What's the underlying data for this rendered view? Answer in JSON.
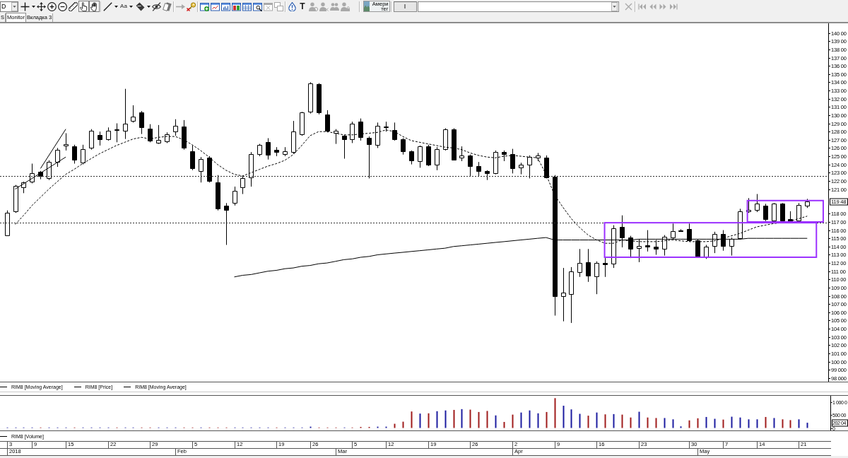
{
  "toolbar": {
    "interval": {
      "value": "D"
    },
    "groups": [
      [
        {
          "kind": "icon",
          "dropdown": true,
          "pressed": false,
          "disabled": false
        },
        {
          "kind": "icon",
          "dropdown": false,
          "pressed": false,
          "disabled": false
        },
        {
          "kind": "icon",
          "dropdown": false,
          "pressed": false,
          "disabled": false
        },
        {
          "kind": "icon",
          "dropdown": false,
          "pressed": false,
          "disabled": false
        },
        {
          "kind": "icon",
          "dropdown": false,
          "pressed": false,
          "disabled": false
        },
        {
          "kind": "icon",
          "dropdown": false,
          "pressed": true,
          "disabled": false
        },
        {
          "kind": "icon",
          "dropdown": false,
          "pressed": true,
          "disabled": false
        }
      ],
      [
        {
          "kind": "icon",
          "dropdown": true,
          "pressed": false,
          "disabled": false
        },
        {
          "kind": "text",
          "label": "Aa",
          "dropdown": true,
          "pressed": false,
          "disabled": false
        },
        {
          "kind": "icon",
          "dropdown": true,
          "pressed": false,
          "disabled": false
        },
        {
          "kind": "icon",
          "dropdown": false,
          "pressed": false,
          "disabled": false
        },
        {
          "kind": "icon",
          "dropdown": false,
          "pressed": false,
          "disabled": false
        }
      ],
      [
        {
          "kind": "icon",
          "dropdown": false,
          "pressed": false,
          "disabled": true
        },
        {
          "kind": "icon",
          "dropdown": false,
          "pressed": false,
          "disabled": false
        }
      ],
      [
        {
          "kind": "icon",
          "dropdown": false,
          "pressed": false,
          "disabled": false
        },
        {
          "kind": "icon",
          "dropdown": false,
          "pressed": false,
          "disabled": false
        },
        {
          "kind": "icon",
          "dropdown": false,
          "pressed": false,
          "disabled": false
        },
        {
          "kind": "icon",
          "dropdown": false,
          "pressed": false,
          "disabled": false
        },
        {
          "kind": "icon",
          "dropdown": false,
          "pressed": false,
          "disabled": false
        },
        {
          "kind": "icon",
          "dropdown": false,
          "pressed": false,
          "disabled": false
        },
        {
          "kind": "icon",
          "dropdown": false,
          "pressed": false,
          "disabled": true
        },
        {
          "kind": "icon",
          "dropdown": false,
          "pressed": false,
          "disabled": true
        }
      ],
      [
        {
          "kind": "icon",
          "dropdown": false,
          "pressed": false,
          "disabled": false
        },
        {
          "kind": "glyph",
          "label": "T",
          "dropdown": false,
          "pressed": false,
          "disabled": false
        },
        {
          "kind": "icon",
          "dropdown": false,
          "pressed": false,
          "disabled": true
        },
        {
          "kind": "icon",
          "dropdown": false,
          "pressed": false,
          "disabled": true
        },
        {
          "kind": "icon",
          "dropdown": false,
          "pressed": false,
          "disabled": true
        },
        {
          "kind": "icon",
          "dropdown": false,
          "pressed": false,
          "disabled": true
        }
      ]
    ],
    "instrument": {
      "lines": [
        "Амери",
        "тег"
      ]
    },
    "field": {
      "value": "I"
    },
    "close": {
      "disabled": true
    },
    "navigation": [
      {
        "disabled": true
      },
      {
        "disabled": true
      },
      {
        "disabled": true
      },
      {
        "disabled": true
      }
    ]
  },
  "tabs": [
    {
      "label": "S",
      "selected": false
    },
    {
      "label": "Monitor",
      "selected": true
    },
    {
      "label": "Вкладка 3",
      "selected": false
    }
  ],
  "price_chart": {
    "last_price_label": "119 48",
    "legend": [
      "RIM8 [Moving Average]",
      "RIM8 [Price]",
      "RIM8 [Moving Average]"
    ],
    "chart_data": {
      "type": "line",
      "ylim": [
        97550,
        141180
      ],
      "yticks": [
        {
          "value": 140000,
          "label": "140 00"
        },
        {
          "value": 139000,
          "label": "139 00"
        },
        {
          "value": 138000,
          "label": "138 00"
        },
        {
          "value": 137000,
          "label": "137 00"
        },
        {
          "value": 136000,
          "label": "136 00"
        },
        {
          "value": 135000,
          "label": "135 00"
        },
        {
          "value": 134000,
          "label": "134 00"
        },
        {
          "value": 133000,
          "label": "133 00"
        },
        {
          "value": 132000,
          "label": "132 00"
        },
        {
          "value": 131000,
          "label": "131 00"
        },
        {
          "value": 130000,
          "label": "130 00"
        },
        {
          "value": 129000,
          "label": "129 00"
        },
        {
          "value": 128000,
          "label": "128 00"
        },
        {
          "value": 127000,
          "label": "127 00"
        },
        {
          "value": 126000,
          "label": "126 00"
        },
        {
          "value": 125000,
          "label": "125 00"
        },
        {
          "value": 124000,
          "label": "124 00"
        },
        {
          "value": 123000,
          "label": "123 00"
        },
        {
          "value": 122000,
          "label": "122 00"
        },
        {
          "value": 121000,
          "label": "121 00"
        },
        {
          "value": 118000,
          "label": "118 00"
        },
        {
          "value": 117000,
          "label": "117 00"
        },
        {
          "value": 116000,
          "label": "116 00"
        },
        {
          "value": 115000,
          "label": "115 00"
        },
        {
          "value": 114000,
          "label": "114 00"
        },
        {
          "value": 113000,
          "label": "113 00"
        },
        {
          "value": 112000,
          "label": "112 00"
        },
        {
          "value": 111000,
          "label": "111 00"
        },
        {
          "value": 110000,
          "label": "110 00"
        },
        {
          "value": 109000,
          "label": "109 00"
        },
        {
          "value": 108000,
          "label": "108 00"
        },
        {
          "value": 107000,
          "label": "107 00"
        },
        {
          "value": 106000,
          "label": "106 00"
        },
        {
          "value": 105000,
          "label": "105 00"
        },
        {
          "value": 104000,
          "label": "104 00"
        },
        {
          "value": 103000,
          "label": "103 00"
        },
        {
          "value": 102000,
          "label": "102 00"
        },
        {
          "value": 101000,
          "label": "101 00"
        },
        {
          "value": 100000,
          "label": "100 00"
        },
        {
          "value": 99000,
          "label": "99 000"
        },
        {
          "value": 98000,
          "label": "98 000"
        }
      ],
      "series": [
        {
          "color": "#000000",
          "line_style": "dashed",
          "values": [
            null,
            116700,
            117800,
            119000,
            120000,
            121000,
            121900,
            122800,
            123400,
            124100,
            124700,
            125300,
            125800,
            126300,
            126700,
            127100,
            127300,
            127100,
            127300,
            127400,
            127400,
            127000,
            126400,
            125700,
            124900,
            124000,
            123300,
            122800,
            122600,
            123000,
            123400,
            123800,
            124100,
            124500,
            125200,
            126300,
            127500,
            128000,
            128000,
            127800,
            127600,
            127600,
            127700,
            127800,
            127900,
            128200,
            128000,
            127400,
            126900,
            126700,
            126500,
            126300,
            126100,
            126000,
            125800,
            125400,
            125100,
            124900,
            124800,
            125000,
            125100,
            125000,
            124900,
            124800,
            122800,
            120300,
            118800,
            117400,
            116300,
            115400,
            114800,
            114400,
            114400,
            114800,
            114700,
            114600,
            114600,
            114600,
            114700,
            114800,
            114700,
            114600,
            114600,
            114600,
            114700,
            115000,
            115300,
            115600,
            116000,
            116400,
            116600,
            116800,
            116900,
            117100,
            117400,
            117700
          ]
        },
        {
          "color": "#000000",
          "values": [
            null,
            null,
            null,
            null,
            null,
            null,
            null,
            null,
            null,
            null,
            null,
            null,
            null,
            null,
            null,
            null,
            null,
            null,
            null,
            null,
            null,
            null,
            null,
            null,
            null,
            null,
            null,
            110300,
            110500,
            110600,
            110800,
            111000,
            111100,
            111300,
            111400,
            111600,
            111700,
            111900,
            112000,
            112200,
            112400,
            112500,
            112700,
            112800,
            113000,
            113100,
            113200,
            113300,
            113400,
            113500,
            113600,
            113700,
            113800,
            114000,
            114100,
            114200,
            114300,
            114400,
            114500,
            114600,
            114700,
            114800,
            114900,
            115000,
            115100,
            114800,
            114800,
            114800,
            114800,
            114800,
            114800,
            114800,
            114800,
            114800,
            114800,
            114900,
            114900,
            114900,
            114900,
            114900,
            114900,
            114900,
            114900,
            114900,
            114900,
            114900,
            114900,
            114900,
            115000,
            115000,
            115000,
            115000,
            115000,
            115000,
            115000,
            115000
          ]
        },
        {
          "color": "#000000",
          "values": [
            null,
            121000,
            null,
            null,
            null,
            null,
            null,
            124900,
            null,
            null,
            null,
            null,
            null,
            null,
            null,
            null,
            null,
            null,
            null,
            null,
            null,
            null,
            null,
            null,
            null,
            null,
            null,
            null,
            null,
            null,
            null,
            null,
            null,
            null,
            null,
            null,
            null,
            null,
            null,
            null,
            null,
            null,
            null,
            null,
            null,
            null,
            null,
            null,
            null,
            null,
            null,
            null,
            null,
            null,
            null,
            null,
            null,
            null,
            null,
            null,
            null,
            null,
            null,
            null,
            null,
            null,
            null,
            null,
            null,
            null,
            null,
            null,
            null,
            null,
            null,
            null,
            null,
            null,
            null,
            null,
            null,
            null,
            null,
            null,
            null,
            null,
            null,
            null,
            null,
            null,
            null,
            null,
            null,
            null,
            null,
            null
          ]
        },
        {
          "color": "#000000",
          "values": [
            null,
            null,
            null,
            null,
            123500,
            null,
            null,
            128300,
            null,
            null,
            null,
            null,
            null,
            null,
            null,
            null,
            null,
            null,
            null,
            null,
            null,
            null,
            null,
            null,
            null,
            null,
            null,
            null,
            null,
            null,
            null,
            null,
            null,
            null,
            null,
            null,
            null,
            null,
            null,
            null,
            null,
            null,
            null,
            null,
            null,
            null,
            null,
            null,
            null,
            null,
            null,
            null,
            null,
            null,
            null,
            null,
            null,
            null,
            null,
            null,
            null,
            null,
            null,
            null,
            null,
            null,
            null,
            null,
            null,
            null,
            null,
            null,
            null,
            null,
            null,
            null,
            null,
            null,
            null,
            null,
            null,
            null,
            null,
            null,
            null,
            null,
            null,
            null,
            null,
            null,
            null,
            null,
            null,
            null,
            null,
            null
          ]
        }
      ],
      "ref_lines": [
        {
          "axis": "y",
          "value": 122600
        },
        {
          "axis": "y",
          "value": 116950
        }
      ]
    }
  },
  "volume_chart": {
    "legend": [
      "RIM8 [Volume]"
    ],
    "axis_labels": [
      "1 000 0",
      "500 00",
      "0"
    ],
    "current_value_label": "202 04"
  },
  "date_axis": {
    "days": [
      "3",
      "9",
      "15",
      "22",
      "29",
      "5",
      "12",
      "19",
      "26",
      "5",
      "12",
      "19",
      "26",
      "2",
      "9",
      "16",
      "23",
      "30",
      "7",
      "14",
      "21"
    ],
    "months": [
      "2018",
      "Feb",
      "Mar",
      "Apr",
      "May"
    ]
  }
}
